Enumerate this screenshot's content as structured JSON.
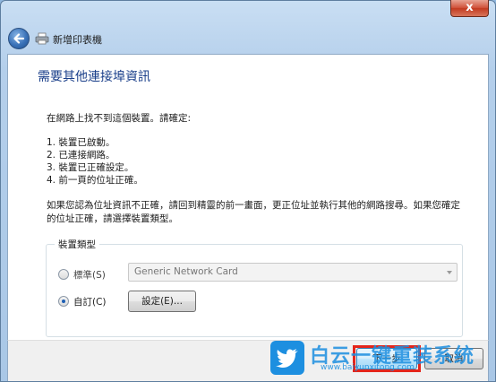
{
  "window": {
    "close_symbol": "x",
    "title": "新增印表機"
  },
  "page": {
    "heading": "需要其他連接埠資訊",
    "intro": "在網路上找不到這個裝置。請確定:",
    "checklist": [
      "1. 裝置已啟動。",
      "2. 已連接網路。",
      "3. 裝置已正確設定。",
      "4. 前一頁的位址正確。"
    ],
    "explanation": "如果您認為位址資訊不正確，請回到精靈的前一畫面，更正位址並執行其他的網路搜尋。如果您確定的位址正確，請選擇裝置類型。"
  },
  "device_type": {
    "group_label": "裝置類型",
    "standard_label": "標準(S)",
    "standard_selected": false,
    "standard_value": "Generic Network Card",
    "custom_label": "自訂(C)",
    "custom_selected": true,
    "settings_button": "設定(E)..."
  },
  "footer": {
    "next_button": "下一步",
    "cancel_button": "取消"
  },
  "watermark": {
    "text": "白云一键重装系统",
    "url": "www.baiyunxitong.com"
  },
  "colors": {
    "accent_heading": "#1a3f8a",
    "highlight": "#e4251b",
    "watermark": "#1d8fe0"
  }
}
